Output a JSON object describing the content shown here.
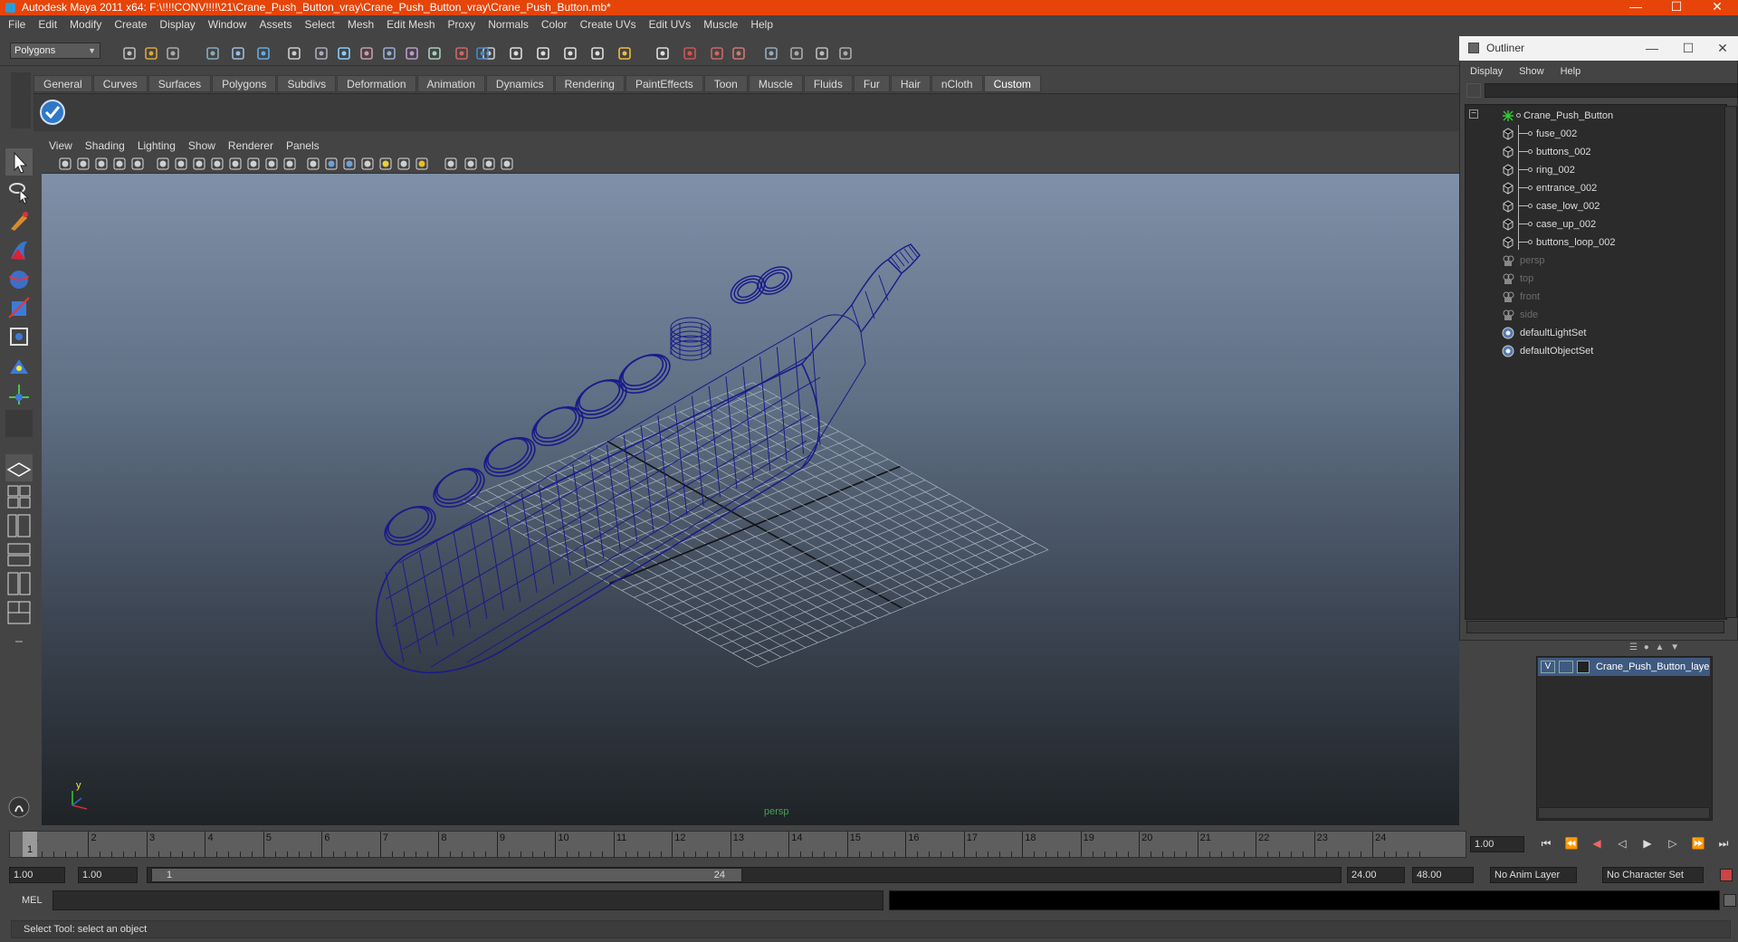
{
  "window": {
    "title": "Autodesk Maya 2011 x64: F:\\!!!!CONV!!!!\\21\\Crane_Push_Button_vray\\Crane_Push_Button_vray\\Crane_Push_Button.mb*",
    "accent": "#e64408"
  },
  "menubar": [
    "File",
    "Edit",
    "Modify",
    "Create",
    "Display",
    "Window",
    "Assets",
    "Select",
    "Mesh",
    "Edit Mesh",
    "Proxy",
    "Normals",
    "Color",
    "Create UVs",
    "Edit UVs",
    "Muscle",
    "Help"
  ],
  "mode_select": {
    "value": "Polygons"
  },
  "shelf": {
    "tabs": [
      "General",
      "Curves",
      "Surfaces",
      "Polygons",
      "Subdivs",
      "Deformation",
      "Animation",
      "Dynamics",
      "Rendering",
      "PaintEffects",
      "Toon",
      "Muscle",
      "Fluids",
      "Fur",
      "Hair",
      "nCloth",
      "Custom"
    ],
    "active_tab": "Custom",
    "item_icon": "check-circle-icon"
  },
  "panel": {
    "menus": [
      "View",
      "Shading",
      "Lighting",
      "Show",
      "Renderer",
      "Panels"
    ],
    "camera_label": "persp",
    "axis_y": "y",
    "axis_x": "x"
  },
  "timeline": {
    "ticks": [
      "1",
      "2",
      "3",
      "4",
      "5",
      "6",
      "7",
      "8",
      "9",
      "10",
      "11",
      "12",
      "13",
      "14",
      "15",
      "16",
      "17",
      "18",
      "19",
      "20",
      "21",
      "22",
      "23",
      "24"
    ],
    "current_frame": "1",
    "current_time_field": "1.00"
  },
  "range": {
    "start_field": "1.00",
    "playback_start": "1.00",
    "slider_start": "1",
    "slider_end": "24",
    "playback_end": "24.00",
    "end_field": "48.00",
    "anim_layer": "No Anim Layer",
    "character_set": "No Character Set"
  },
  "command": {
    "label": "MEL"
  },
  "status": {
    "help_line": "Select Tool: select an object"
  },
  "outliner": {
    "title": "Outliner",
    "menus": [
      "Display",
      "Show",
      "Help"
    ],
    "items": [
      {
        "label": "Crane_Push_Button",
        "depth": 0,
        "type": "group",
        "dim": false
      },
      {
        "label": "fuse_002",
        "depth": 1,
        "type": "mesh",
        "dim": false
      },
      {
        "label": "buttons_002",
        "depth": 1,
        "type": "mesh",
        "dim": false
      },
      {
        "label": "ring_002",
        "depth": 1,
        "type": "mesh",
        "dim": false
      },
      {
        "label": "entrance_002",
        "depth": 1,
        "type": "mesh",
        "dim": false
      },
      {
        "label": "case_low_002",
        "depth": 1,
        "type": "mesh",
        "dim": false
      },
      {
        "label": "case_up_002",
        "depth": 1,
        "type": "mesh",
        "dim": false
      },
      {
        "label": "buttons_loop_002",
        "depth": 1,
        "type": "mesh",
        "dim": false
      },
      {
        "label": "persp",
        "depth": 0,
        "type": "camera",
        "dim": true
      },
      {
        "label": "top",
        "depth": 0,
        "type": "camera",
        "dim": true
      },
      {
        "label": "front",
        "depth": 0,
        "type": "camera",
        "dim": true
      },
      {
        "label": "side",
        "depth": 0,
        "type": "camera",
        "dim": true
      },
      {
        "label": "defaultLightSet",
        "depth": 0,
        "type": "set",
        "dim": false
      },
      {
        "label": "defaultObjectSet",
        "depth": 0,
        "type": "set",
        "dim": false
      }
    ]
  },
  "layers": {
    "rows": [
      {
        "visible": "V",
        "name": "Crane_Push_Button_laye"
      }
    ]
  }
}
